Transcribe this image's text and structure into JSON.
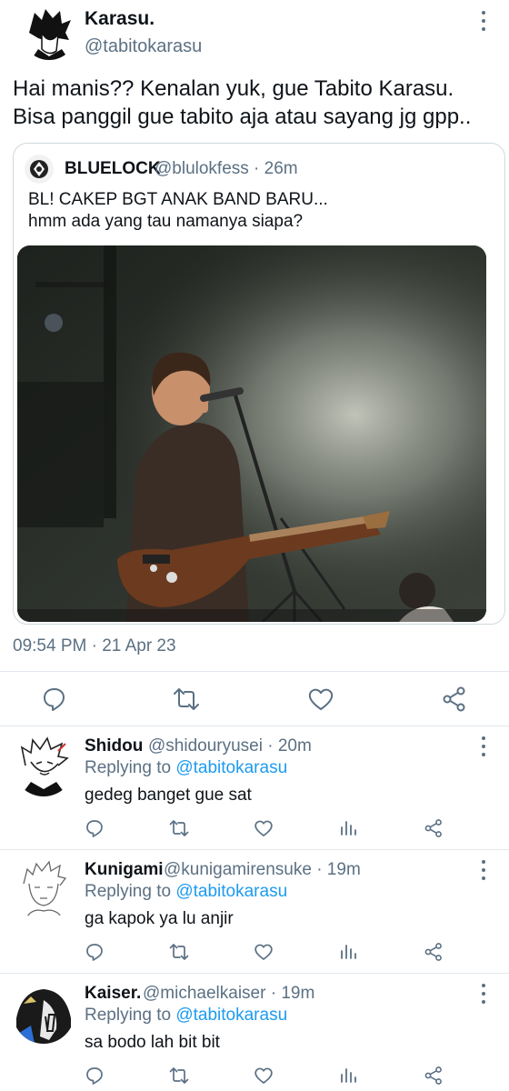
{
  "main_tweet": {
    "name": "Karasu.",
    "handle": "@tabitokarasu",
    "text_lines": [
      "Hai manis?? Kenalan yuk, gue Tabito Karasu.",
      "Bisa panggil gue tabito aja atau sayang jg gpp.."
    ],
    "timestamp": "09:54 PM · 21 Apr 23"
  },
  "quote": {
    "name": "BLUELOCK",
    "handle_time": "@blulokfess · 26m",
    "text_lines": [
      "BL! CAKEP BGT ANAK BAND BARU...",
      "hmm ada yang tau namanya siapa?"
    ]
  },
  "actions": [
    "reply-icon",
    "retweet-icon",
    "like-icon",
    "share-icon"
  ],
  "replies": [
    {
      "name": "Shidou",
      "handle_time": "@shidouryusei · 20m",
      "replying_prefix": "Replying to",
      "replying_to": "@tabitokarasu",
      "text": "gedeg banget gue sat"
    },
    {
      "name": "Kunigami",
      "handle_time": "@kunigamirensuke · 19m",
      "replying_prefix": "Replying to",
      "replying_to": "@tabitokarasu",
      "text": "ga kapok ya lu anjir"
    },
    {
      "name": "Kaiser.",
      "handle_time": "@michaelkaiser · 19m",
      "replying_prefix": "Replying to",
      "replying_to": "@tabitokarasu",
      "text": "sa bodo lah bit bit"
    }
  ],
  "colors": {
    "text": "#0f1419",
    "secondary": "#5b7083",
    "link": "#1d9bf0",
    "border": "#cfd9de",
    "divider": "#e1e8ed"
  }
}
